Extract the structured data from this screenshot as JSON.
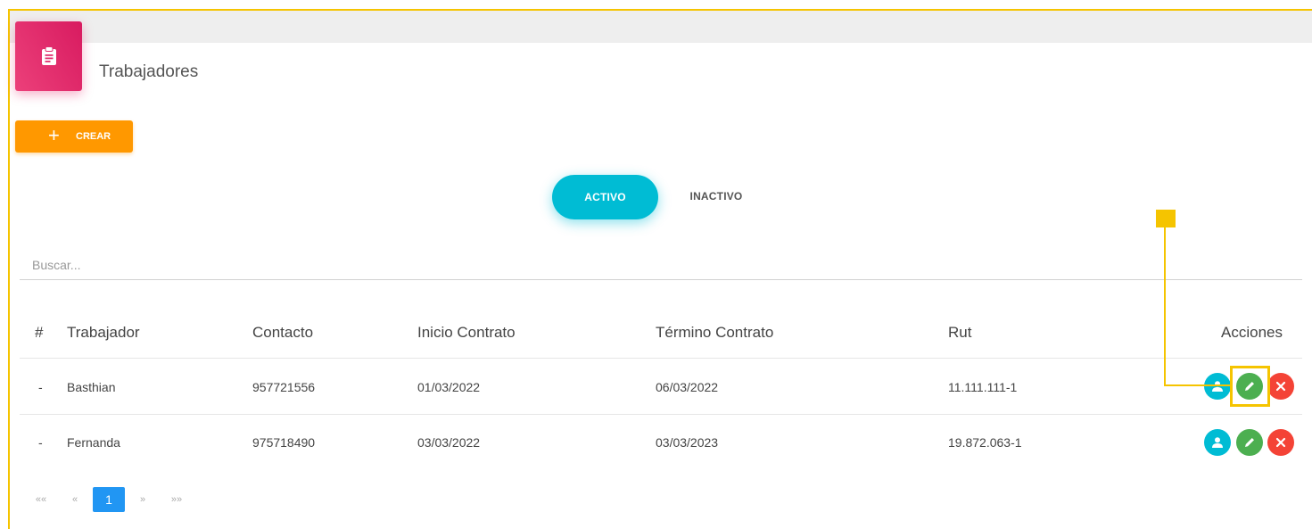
{
  "page": {
    "title": "Trabajadores",
    "accent_color": "#e91e63",
    "header_icon": "clipboard-icon"
  },
  "toolbar": {
    "create_label": "CREAR",
    "create_icon": "plus-icon",
    "create_color": "#ff9800"
  },
  "tabs": [
    {
      "label": "ACTIVO",
      "active": true
    },
    {
      "label": "INACTIVO",
      "active": false
    }
  ],
  "search": {
    "placeholder": "Buscar...",
    "value": ""
  },
  "table": {
    "headers": [
      "#",
      "Trabajador",
      "Contacto",
      "Inicio Contrato",
      "Término Contrato",
      "Rut",
      "Acciones"
    ],
    "rows": [
      {
        "index": "-",
        "trabajador": "Basthian",
        "contacto": "957721556",
        "inicio": "01/03/2022",
        "termino": "06/03/2022",
        "rut": "11.111.111-1"
      },
      {
        "index": "-",
        "trabajador": "Fernanda",
        "contacto": "975718490",
        "inicio": "03/03/2022",
        "termino": "03/03/2023",
        "rut": "19.872.063-1"
      }
    ],
    "action_icons": [
      "user-icon",
      "edit-icon",
      "delete-icon"
    ]
  },
  "pagination": {
    "first": "««",
    "prev": "«",
    "current": "1",
    "next": "»",
    "last": "»»"
  }
}
